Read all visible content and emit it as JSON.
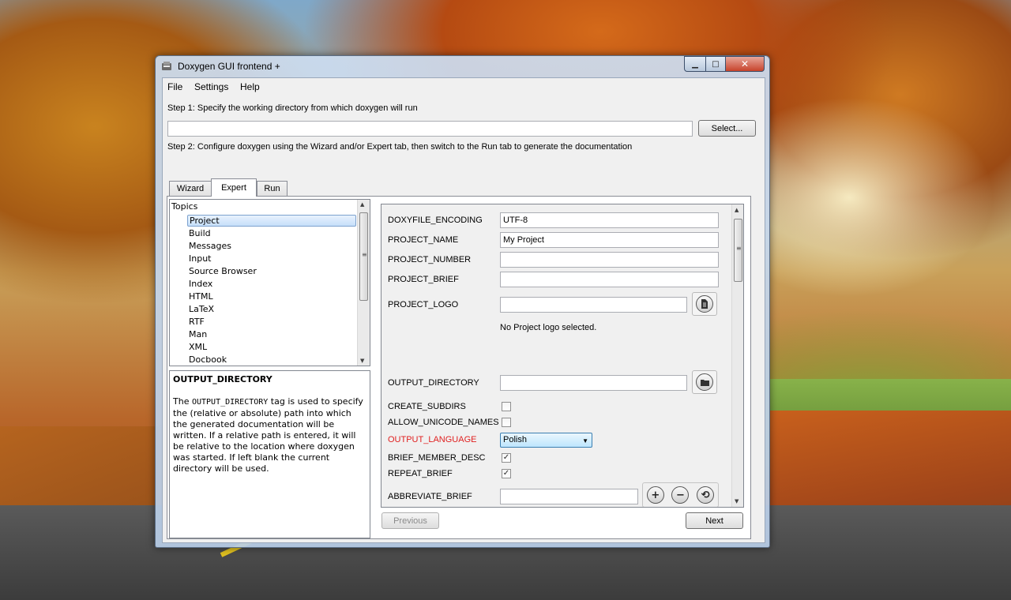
{
  "window": {
    "title": "Doxygen GUI frontend +",
    "minimize": "▁",
    "maximize": "□",
    "close": "✕",
    "icon": "doxygen-app-icon"
  },
  "menu": {
    "items": [
      "File",
      "Settings",
      "Help"
    ]
  },
  "step1": {
    "label": "Step 1: Specify the working directory from which doxygen will run",
    "value": "",
    "select_button": "Select..."
  },
  "step2": {
    "label": "Step 2: Configure doxygen using the Wizard and/or Expert tab, then switch to the Run tab to generate the documentation"
  },
  "tabs": [
    {
      "label": "Wizard"
    },
    {
      "label": "Expert",
      "active": true
    },
    {
      "label": "Run"
    }
  ],
  "topics": {
    "header": "Topics",
    "selected": "Project",
    "items": [
      "Project",
      "Build",
      "Messages",
      "Input",
      "Source Browser",
      "Index",
      "HTML",
      "LaTeX",
      "RTF",
      "Man",
      "XML",
      "Docbook"
    ]
  },
  "help": {
    "title": "OUTPUT_DIRECTORY",
    "pre": "The ",
    "code": "OUTPUT_DIRECTORY",
    "post": " tag is used to specify the (relative or absolute) path into which the generated documentation will be written. If a relative path is entered, it will be relative to the location where doxygen was started. If left blank the current directory will be used."
  },
  "options": {
    "doxyfile_encoding": {
      "label": "DOXYFILE_ENCODING",
      "value": "UTF-8"
    },
    "project_name": {
      "label": "PROJECT_NAME",
      "value": "My Project"
    },
    "project_number": {
      "label": "PROJECT_NUMBER",
      "value": ""
    },
    "project_brief": {
      "label": "PROJECT_BRIEF",
      "value": ""
    },
    "project_logo": {
      "label": "PROJECT_LOGO",
      "value": "",
      "note": "No Project logo selected."
    },
    "output_directory": {
      "label": "OUTPUT_DIRECTORY",
      "value": ""
    },
    "create_subdirs": {
      "label": "CREATE_SUBDIRS",
      "checked": false
    },
    "allow_unicode_names": {
      "label": "ALLOW_UNICODE_NAMES",
      "checked": false
    },
    "output_language": {
      "label": "OUTPUT_LANGUAGE",
      "value": "Polish",
      "modified_color": "#e02020"
    },
    "brief_member_desc": {
      "label": "BRIEF_MEMBER_DESC",
      "checked": true,
      "mark": "✓"
    },
    "repeat_brief": {
      "label": "REPEAT_BRIEF",
      "checked": true,
      "mark": "✓"
    },
    "abbreviate_brief": {
      "label": "ABBREVIATE_BRIEF",
      "value": "",
      "add": "+",
      "remove": "−",
      "reset": "⟲"
    }
  },
  "nav": {
    "previous": "Previous",
    "next": "Next"
  },
  "icons": {
    "file": "file-browse-icon",
    "folder": "folder-browse-icon",
    "scroll_up": "▲",
    "scroll_down": "▼",
    "grip": "≡",
    "dropdown": "▼"
  }
}
